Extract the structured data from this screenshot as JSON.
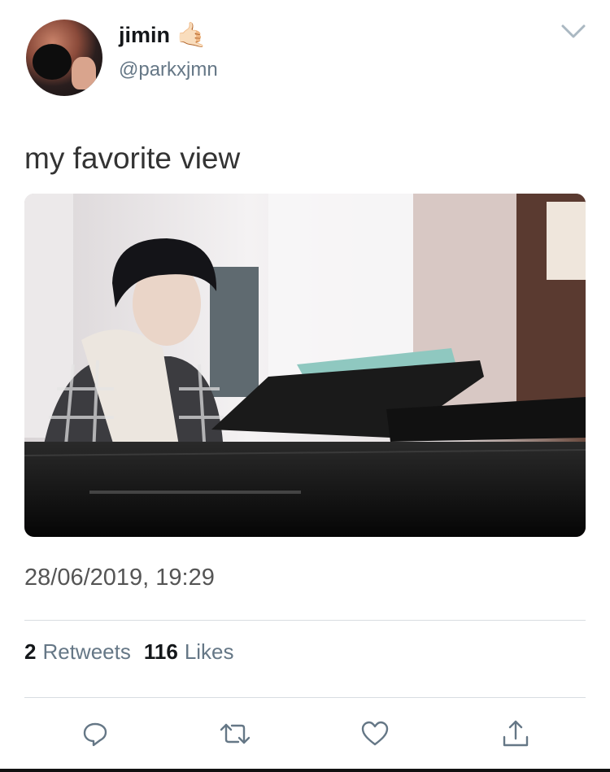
{
  "tweet": {
    "author": {
      "display_name": "jimin",
      "emoji": "🤙🏻",
      "handle": "@parkxjmn"
    },
    "text": "my favorite view",
    "timestamp": "28/06/2019, 19:29",
    "stats": {
      "retweets_count": "2",
      "retweets_label": "Retweets",
      "likes_count": "116",
      "likes_label": "Likes"
    }
  },
  "icons": {
    "menu": "chevron-down-icon",
    "reply": "reply-icon",
    "retweet": "retweet-icon",
    "like": "heart-icon",
    "share": "share-icon"
  },
  "colors": {
    "text_primary": "#14171a",
    "text_secondary": "#657786",
    "divider": "#d8dde1",
    "icon": "#657786"
  }
}
